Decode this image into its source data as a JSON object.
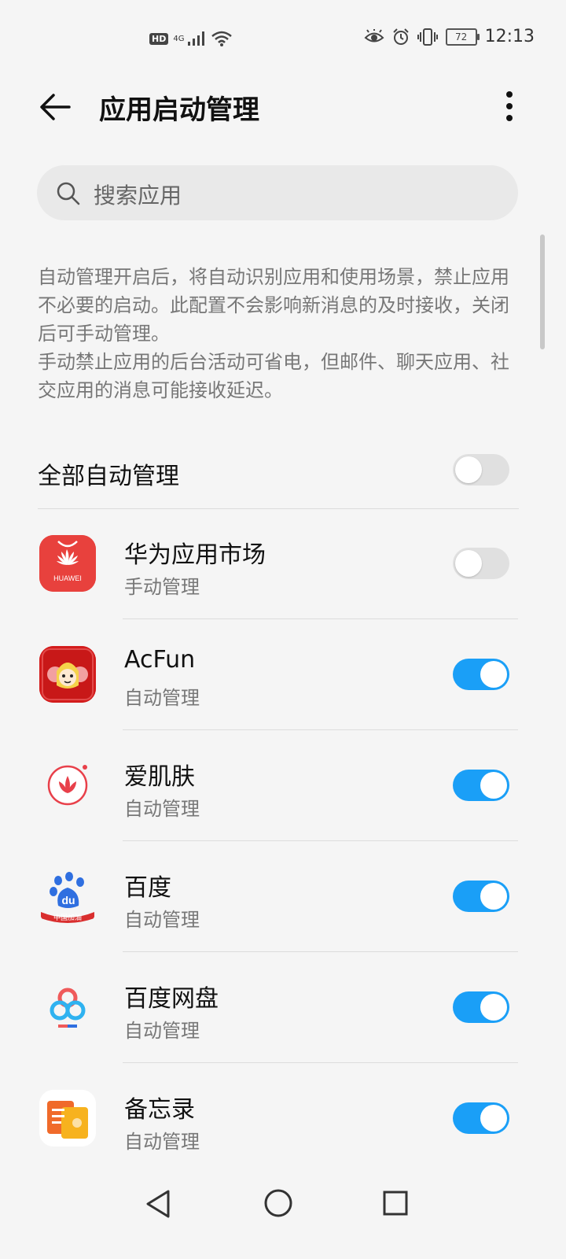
{
  "status_bar": {
    "hd_label": "HD",
    "network_label": "4G",
    "battery_level": "72",
    "time": "12:13"
  },
  "header": {
    "title": "应用启动管理"
  },
  "search": {
    "placeholder": "搜索应用"
  },
  "description": {
    "paragraph1": "自动管理开启后，将自动识别应用和使用场景，禁止应用不必要的启动。此配置不会影响新消息的及时接收，关闭后可手动管理。",
    "paragraph2": "手动禁止应用的后台活动可省电，但邮件、聊天应用、社交应用的消息可能接收延迟。"
  },
  "all_auto": {
    "label": "全部自动管理",
    "enabled": false
  },
  "apps": [
    {
      "name": "华为应用市场",
      "mode": "手动管理",
      "enabled": false,
      "icon": "huawei-appgallery-icon",
      "icon_text": "HUAWEI"
    },
    {
      "name": "AcFun",
      "mode": "自动管理",
      "enabled": true,
      "icon": "acfun-icon"
    },
    {
      "name": "爱肌肤",
      "mode": "自动管理",
      "enabled": true,
      "icon": "aijifu-icon"
    },
    {
      "name": "百度",
      "mode": "自动管理",
      "enabled": true,
      "icon": "baidu-icon",
      "icon_text": "du",
      "icon_subtext": "中国加油"
    },
    {
      "name": "百度网盘",
      "mode": "自动管理",
      "enabled": true,
      "icon": "baidu-netdisk-icon"
    },
    {
      "name": "备忘录",
      "mode": "自动管理",
      "enabled": true,
      "icon": "notepad-icon"
    }
  ],
  "colors": {
    "toggle_on": "#1a9ff7",
    "toggle_off": "#e0e0e0",
    "background": "#f5f5f5"
  }
}
